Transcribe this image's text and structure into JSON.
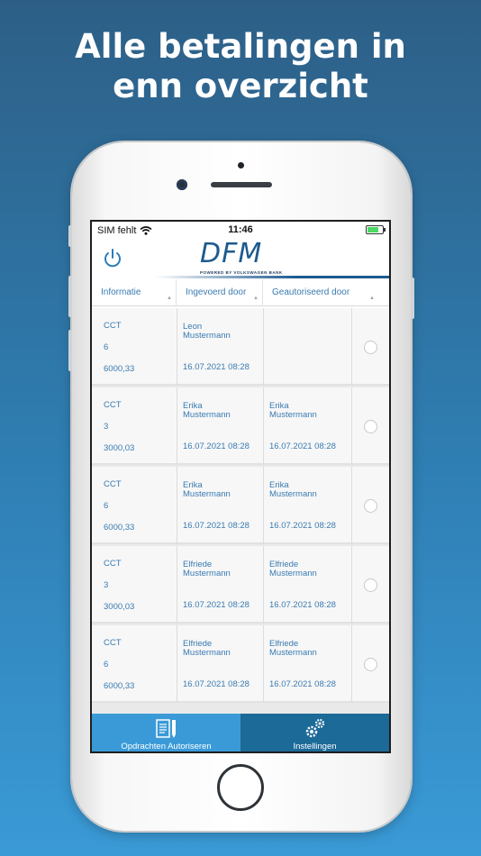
{
  "promo": {
    "line1": "Alle betalingen in",
    "line2": "enn overzicht"
  },
  "status_bar": {
    "carrier": "SIM fehlt",
    "time": "11:46"
  },
  "header": {
    "logo_text": "DFM",
    "logo_sub": "POWERED BY VOLKSWAGEN BANK",
    "brand_color": "#1c5a8f"
  },
  "columns": [
    "Informatie",
    "Ingevoerd door",
    "Geautoriseerd door"
  ],
  "rows": [
    {
      "type": "CCT",
      "count": "6",
      "amount": "6000,33",
      "entered_by": [
        "Leon",
        "Mustermann"
      ],
      "entered_date": "16.07.2021 08:28",
      "authorized_by": [],
      "authorized_date": ""
    },
    {
      "type": "CCT",
      "count": "3",
      "amount": "3000,03",
      "entered_by": [
        "Erika",
        "Mustermann"
      ],
      "entered_date": "16.07.2021 08:28",
      "authorized_by": [
        "Erika",
        "Mustermann"
      ],
      "authorized_date": "16.07.2021 08:28"
    },
    {
      "type": "CCT",
      "count": "6",
      "amount": "6000,33",
      "entered_by": [
        "Erika",
        "Mustermann"
      ],
      "entered_date": "16.07.2021 08:28",
      "authorized_by": [
        "Erika",
        "Mustermann"
      ],
      "authorized_date": "16.07.2021 08:28"
    },
    {
      "type": "CCT",
      "count": "3",
      "amount": "3000,03",
      "entered_by": [
        "Elfriede",
        "Mustermann"
      ],
      "entered_date": "16.07.2021 08:28",
      "authorized_by": [
        "Elfriede",
        "Mustermann"
      ],
      "authorized_date": "16.07.2021 08:28"
    },
    {
      "type": "CCT",
      "count": "6",
      "amount": "6000,33",
      "entered_by": [
        "Elfriede",
        "Mustermann"
      ],
      "entered_date": "16.07.2021 08:28",
      "authorized_by": [
        "Elfriede",
        "Mustermann"
      ],
      "authorized_date": "16.07.2021 08:28"
    }
  ],
  "tabs": [
    {
      "label": "Opdrachten Autoriseren",
      "icon": "document-pen-icon",
      "active": true
    },
    {
      "label": "Instellingen",
      "icon": "gears-icon",
      "active": false
    }
  ],
  "colors": {
    "accent": "#3a7bb1",
    "tab_active": "#3a9ad8",
    "tab_inactive": "#1c6a98"
  }
}
